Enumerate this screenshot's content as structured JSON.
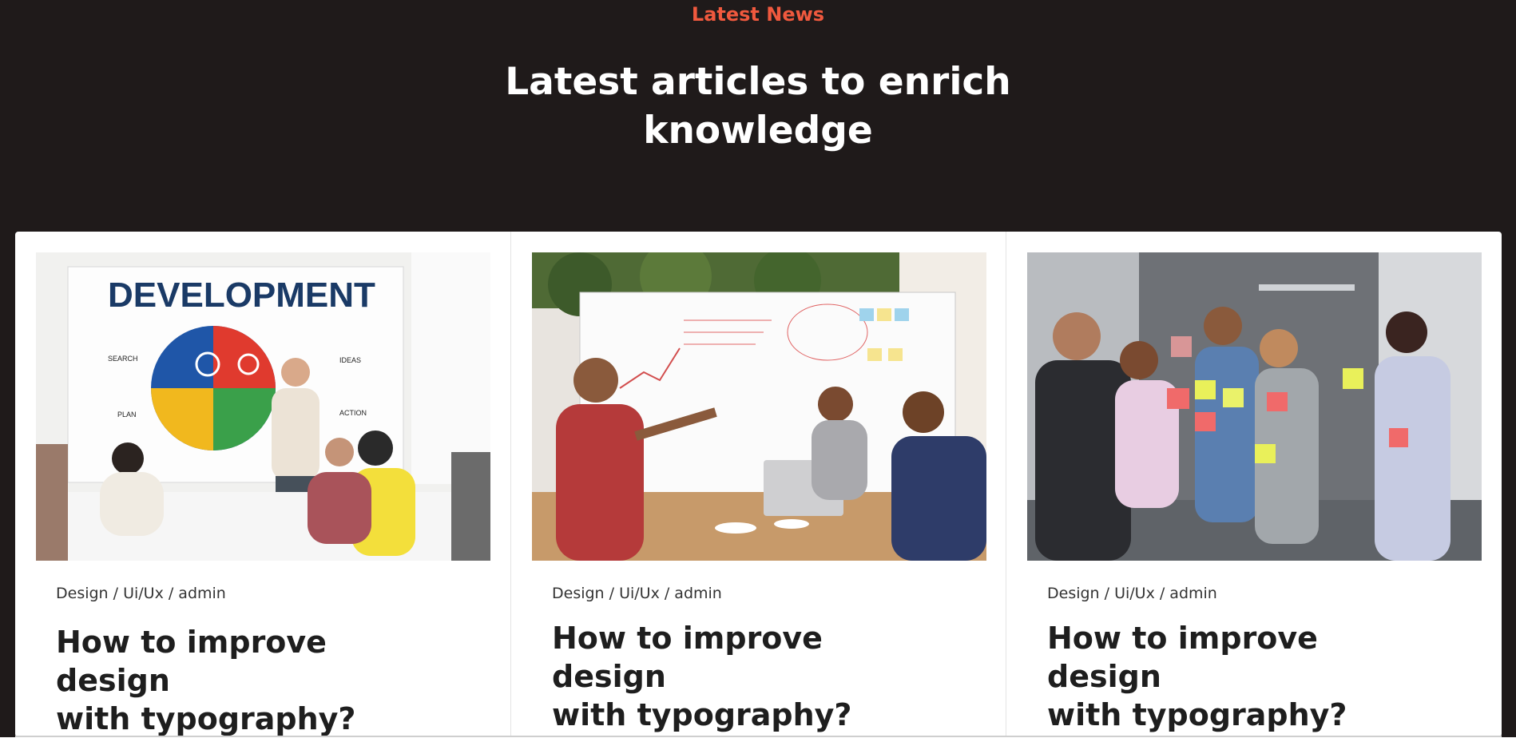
{
  "section": {
    "eyebrow": "Latest News",
    "heading_line1": "Latest articles to enrich",
    "heading_line2": "knowledge"
  },
  "articles": [
    {
      "meta": "Design / Ui/Ux / admin",
      "title_line1": "How to improve design",
      "title_line2": "with typography?",
      "image_text": {
        "banner": "DEVELOPMENT",
        "search": "SEARCH",
        "ideas": "IDEAS",
        "plan": "PLAN",
        "action": "ACTION"
      }
    },
    {
      "meta": "Design / Ui/Ux / admin",
      "title_line1": "How to improve design",
      "title_line2": "with typography?"
    },
    {
      "meta": "Design / Ui/Ux / admin",
      "title_line1": "How to improve design",
      "title_line2": "with typography?"
    }
  ],
  "colors": {
    "background": "#1f1a1a",
    "accent": "#f0593e",
    "heading": "#ffffff",
    "card": "#ffffff"
  }
}
